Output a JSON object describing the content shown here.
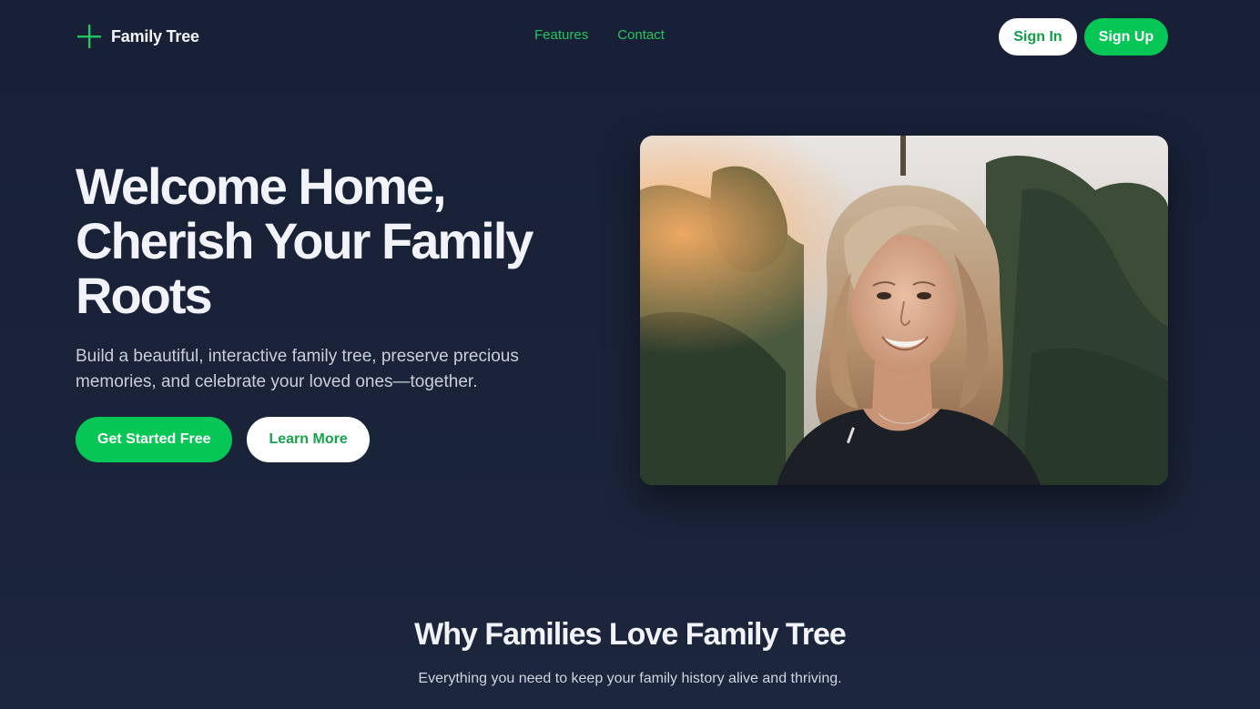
{
  "nav": {
    "brand": "Family Tree",
    "brand_icon": "plus-icon",
    "links": [
      "Features",
      "Contact"
    ],
    "sign_in": "Sign In",
    "sign_up": "Sign Up"
  },
  "hero": {
    "title": "Welcome Home, Cherish Your Family Roots",
    "subtitle": "Build a beautiful, interactive family tree, preserve precious memories, and celebrate your loved ones—together.",
    "primary_cta": "Get Started Free",
    "secondary_cta": "Learn More",
    "image_subject": "smiling woman with shoulder-length blonde hair outdoors"
  },
  "features": {
    "title": "Why Families Love Family Tree",
    "subtitle": "Everything you need to keep your family history alive and thriving."
  },
  "colors": {
    "background": "#182036",
    "accent": "#06c755",
    "accent_text": "#22c55e",
    "heading": "#f1f3f8",
    "body_text": "#c9cfdb"
  }
}
